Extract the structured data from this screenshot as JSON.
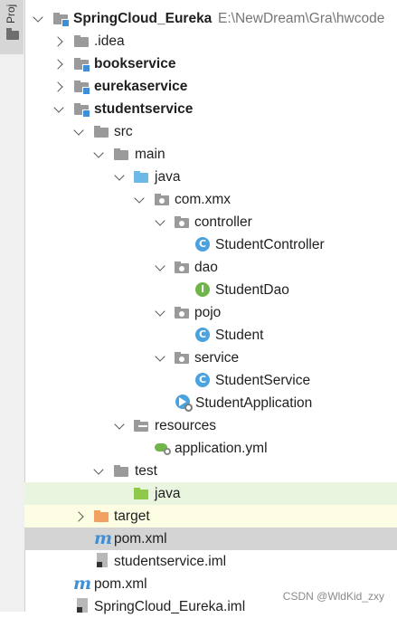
{
  "sidebar": {
    "tab_label": "Proj"
  },
  "tree": {
    "root": {
      "name": "SpringCloud_Eureka",
      "path": "E:\\NewDream\\Gra\\hwcode"
    },
    "idea": ".idea",
    "bookservice": "bookservice",
    "eurekaservice": "eurekaservice",
    "studentservice": "studentservice",
    "src": "src",
    "main": "main",
    "java": "java",
    "com_xmx": "com.xmx",
    "controller": "controller",
    "student_controller": "StudentController",
    "dao": "dao",
    "student_dao": "StudentDao",
    "pojo": "pojo",
    "student": "Student",
    "service": "service",
    "student_service": "StudentService",
    "student_application": "StudentApplication",
    "resources": "resources",
    "application_yml": "application.yml",
    "test": "test",
    "test_java": "java",
    "target": "target",
    "pom_xml": "pom.xml",
    "studentservice_iml": "studentservice.iml",
    "root_pom_xml": "pom.xml",
    "root_iml": "SpringCloud_Eureka.iml"
  },
  "icons": {
    "class_badge": "C",
    "interface_badge": "I",
    "maven_icon": "m"
  },
  "watermark": "CSDN @WldKid_zxy"
}
